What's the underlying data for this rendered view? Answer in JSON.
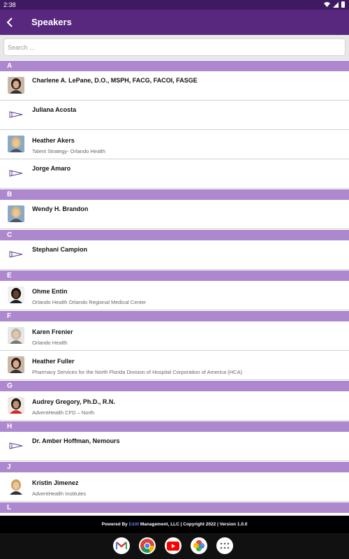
{
  "status_bar": {
    "time": "2:38"
  },
  "app_bar": {
    "title": "Speakers"
  },
  "search": {
    "placeholder": "Search ..."
  },
  "sections": [
    {
      "letter": "A",
      "speakers": [
        {
          "name": "Charlene A. LePane, D.O., MSPH, FACG, FACOI, FASGE",
          "subtitle": "",
          "photo": "photo-woman-dark-hair"
        },
        {
          "name": "Juliana Acosta",
          "subtitle": "",
          "photo": "placeholder-icon"
        },
        {
          "name": "Heather Akers",
          "subtitle": "Talent Strategy- Orlando Health",
          "photo": "photo-woman-blonde"
        },
        {
          "name": "Jorge Amaro",
          "subtitle": "",
          "photo": "placeholder-icon"
        }
      ]
    },
    {
      "letter": "B",
      "speakers": [
        {
          "name": "Wendy H. Brandon",
          "subtitle": "",
          "photo": "photo-woman-blonde"
        }
      ]
    },
    {
      "letter": "C",
      "speakers": [
        {
          "name": "Stephani Campion",
          "subtitle": "",
          "photo": "placeholder-icon"
        }
      ]
    },
    {
      "letter": "E",
      "speakers": [
        {
          "name": "Ohme Entin",
          "subtitle": "Orlando Health Orlando Regional Medical Center",
          "photo": "photo-woman-dark-skin"
        }
      ]
    },
    {
      "letter": "F",
      "speakers": [
        {
          "name": "Karen Frenier",
          "subtitle": "Orlando Health",
          "photo": "photo-woman-gray-hair"
        },
        {
          "name": "Heather Fuller",
          "subtitle": "Pharmacy Services for the North Florida Division of Hospital Corporation of America (HCA)",
          "photo": "photo-woman-dark-hair"
        }
      ]
    },
    {
      "letter": "G",
      "speakers": [
        {
          "name": "Audrey Gregory, Ph.D., R.N.",
          "subtitle": "AdventHealth CFD – North",
          "photo": "photo-woman-red-jacket"
        }
      ]
    },
    {
      "letter": "H",
      "speakers": [
        {
          "name": "Dr. Amber Hoffman, Nemours",
          "subtitle": "",
          "photo": "placeholder-icon"
        }
      ]
    },
    {
      "letter": "J",
      "speakers": [
        {
          "name": "Kristin Jimenez",
          "subtitle": "AdventHealth Institutes",
          "photo": "photo-woman-blonde-long"
        }
      ]
    },
    {
      "letter": "L",
      "speakers": []
    }
  ],
  "footer": {
    "prefix": "Powered By ",
    "brand": "E&M",
    "suffix": " Management, LLC | Copyright 2022 | Version 1.0.0"
  },
  "dock": [
    "gmail-icon",
    "chrome-icon",
    "youtube-icon",
    "photos-icon",
    "app-drawer-icon"
  ],
  "colors": {
    "status_bar": "#3f1a63",
    "app_bar": "#58277e",
    "section_header": "#ad88cf",
    "footer": "#000000"
  }
}
